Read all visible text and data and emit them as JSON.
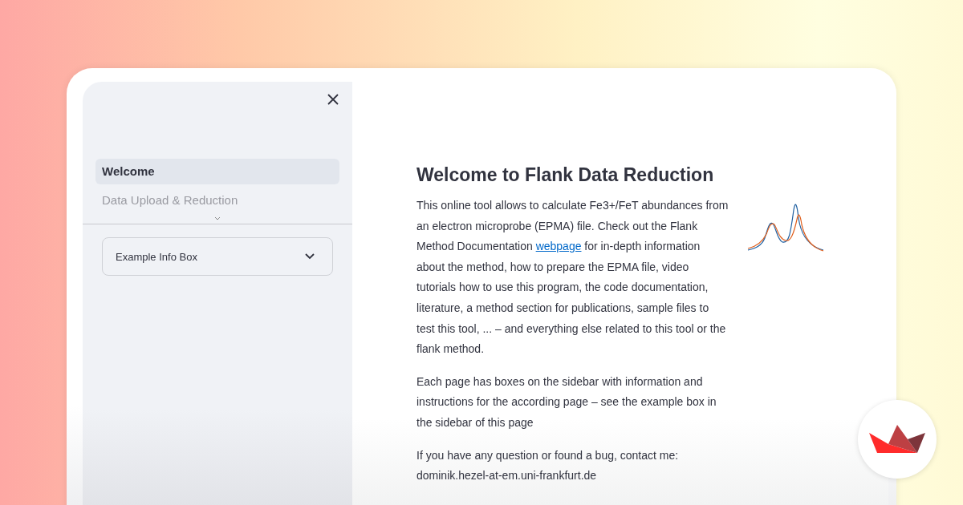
{
  "sidebar": {
    "nav_items": [
      {
        "label": "Welcome",
        "selected": true
      },
      {
        "label": "Data Upload & Reduction",
        "selected": false
      }
    ],
    "expander": {
      "label": "Example Info Box",
      "expanded": false
    }
  },
  "main": {
    "title": "Welcome to Flank Data Reduction",
    "paragraphs": [
      {
        "before": "This online tool allows to calculate Fe3+/FeT abundances from an electron microprobe (EPMA) file. Check out the Flank Method Documentation ",
        "link": "webpage",
        "after": " for in-depth information about the method, how to prepare the EPMA file, video tutorials how to use this program, the code documentation, literature, a method section for publications, sample files to test this tool, ... – and everything else related to this tool or the flank method."
      },
      {
        "before": "Each page has boxes on the sidebar with information and instructions for the according page – see the example box in the sidebar of this page"
      },
      {
        "before": "If you have any question or found a bug, contact me: dominik.hezel-at-em.uni-frankfurt.de"
      }
    ]
  }
}
